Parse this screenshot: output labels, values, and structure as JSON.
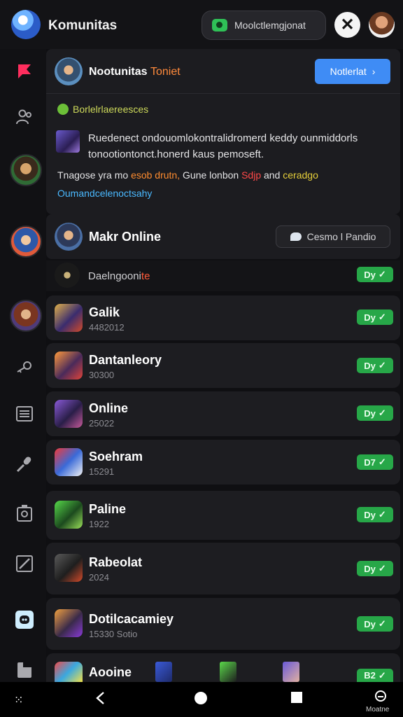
{
  "header": {
    "title": "Komunitas",
    "search_label": "Moolctlemgjonat"
  },
  "notification": {
    "title_main": "Nootunitas",
    "title_accent": "Toniet",
    "button_label": "Notlerlat",
    "subtitle": "Borlelrlaereesces",
    "body_line1": "Ruedenect ondouomlokontralidromerd keddy ounmiddorls",
    "body_line2": "tonootiontonct.honerd kaus pemoseft.",
    "line3_a": "Tnagose yra mo",
    "line3_b": "esob drutn,",
    "line3_c": "Gune lonbon",
    "line3_d": "Sdjp",
    "line3_e": "and",
    "line3_f": "ceradgo",
    "line4": "Oumandcelenoctsahy"
  },
  "online_section": {
    "title": "Makr Online",
    "button_label": "Cesmo l Pandio"
  },
  "first_row": {
    "label_main": "Daelngooni",
    "label_accent": "te",
    "badge": "Dy"
  },
  "rows": [
    {
      "title": "Galik",
      "count": "4482012",
      "badge": "Dy"
    },
    {
      "title": "Dantanleory",
      "count": "30300",
      "badge": "Dy"
    },
    {
      "title": "Online",
      "count": "25022",
      "badge": "Dy"
    },
    {
      "title": "Soehram",
      "count": "15291",
      "badge": "D7"
    },
    {
      "title": "Paline",
      "count": "1922",
      "badge": "Dy"
    },
    {
      "title": "Rabeolat",
      "count": "2024",
      "badge": "Dy"
    },
    {
      "title": "Dotilcacamiey",
      "count": "15330",
      "count_accent": "Sotio",
      "badge": "Dy"
    },
    {
      "title": "Aooine",
      "count": "",
      "badge": "B2"
    }
  ],
  "bottom_nav": {
    "label": "Moatne"
  },
  "icons": [
    "app-logo",
    "chat-bubble-icon",
    "x-close-icon",
    "flag-icon",
    "users-icon",
    "key-icon",
    "list-icon",
    "mic-icon",
    "camera-icon",
    "edit-icon",
    "discord-icon",
    "note-icon",
    "check-icon",
    "chevron-right-icon",
    "grid-icon",
    "back-icon",
    "home-icon",
    "square-icon"
  ],
  "colors": {
    "accent_blue": "#3f8cf5",
    "success_green": "#27a748",
    "orange": "#ff8a3c",
    "background": "#0f0f12"
  }
}
